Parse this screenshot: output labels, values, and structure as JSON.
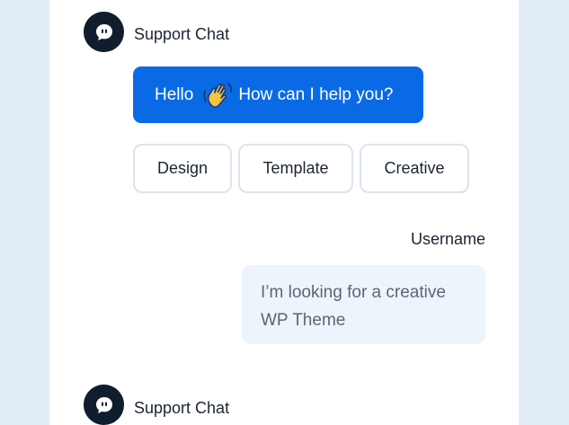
{
  "messages": {
    "bot_first": {
      "sender": "Support Chat",
      "text_before_emoji": "Hello",
      "emoji": "waving-hand",
      "text_after_emoji": "How can I help you?"
    },
    "quick_replies": [
      "Design",
      "Template",
      "Creative"
    ],
    "user_message": {
      "sender": "Username",
      "text": "I’m looking for a creative WP Theme"
    },
    "bot_second": {
      "sender": "Support Chat"
    }
  },
  "icons": {
    "avatar": "chat-bubble-icon",
    "emoji": "waving-hand-icon"
  },
  "colors": {
    "page_background": "#e3edf8",
    "panel_background": "#ffffff",
    "bot_bubble": "#0a6ae6",
    "avatar_background": "#0f1d2c",
    "user_bubble": "#eef4fc",
    "chip_border": "#dde4ee"
  }
}
